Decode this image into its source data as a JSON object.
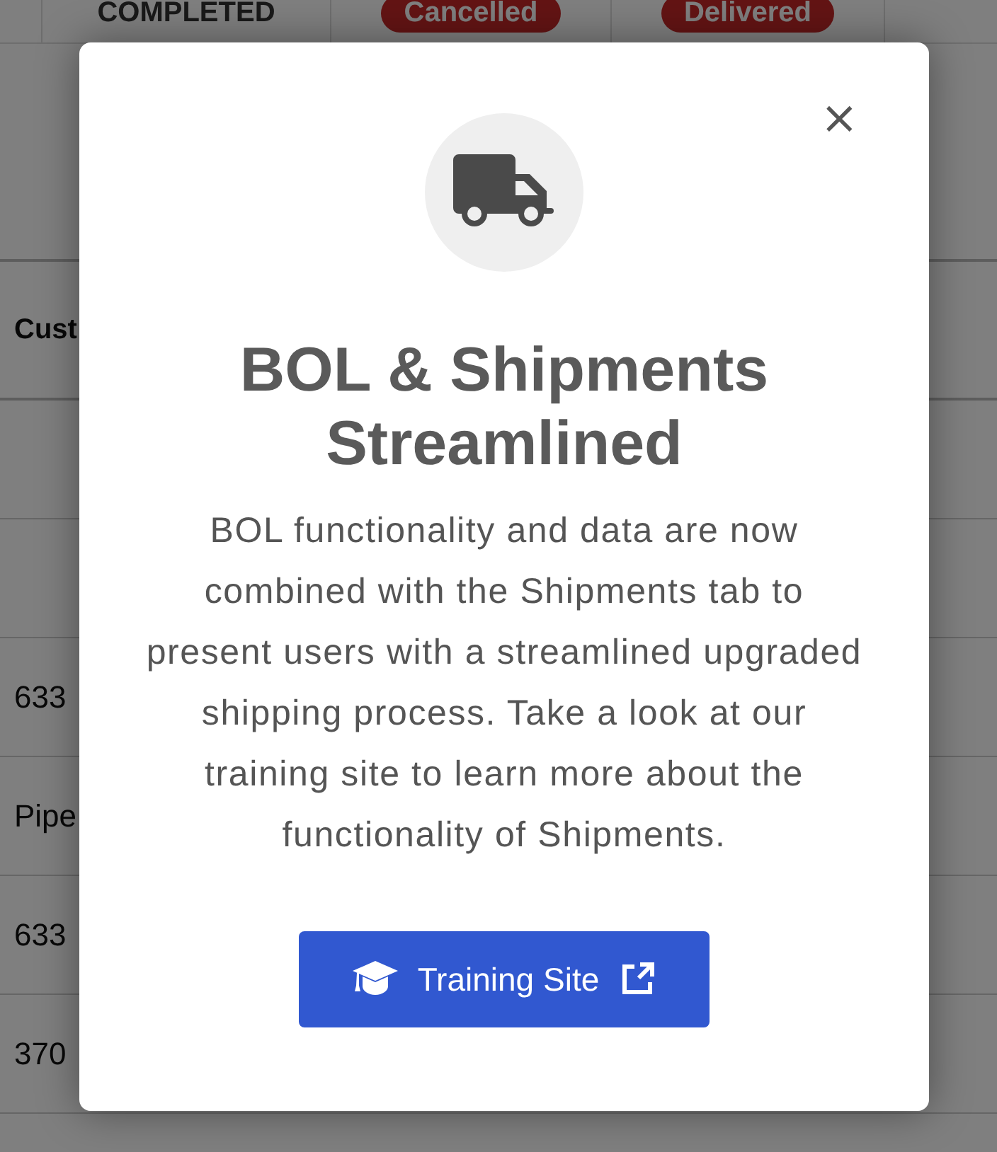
{
  "background_table": {
    "top_row": [
      {
        "kind": "status",
        "text": "COMPLETED"
      },
      {
        "kind": "badge",
        "text": "Cancelled"
      },
      {
        "kind": "badge",
        "text": "Delivered"
      }
    ],
    "header": "Cust",
    "rows": [
      "",
      "",
      "633",
      "Pipe",
      "633",
      "370",
      ""
    ]
  },
  "modal": {
    "title": "BOL & Shipments Streamlined",
    "message": "BOL functionality and data are now combined with the Shipments tab to present users with a streamlined upgraded shipping process. Take a look at our training site to learn more about the functionality of Shipments.",
    "close": "×",
    "button": {
      "label": "Training Site"
    }
  }
}
